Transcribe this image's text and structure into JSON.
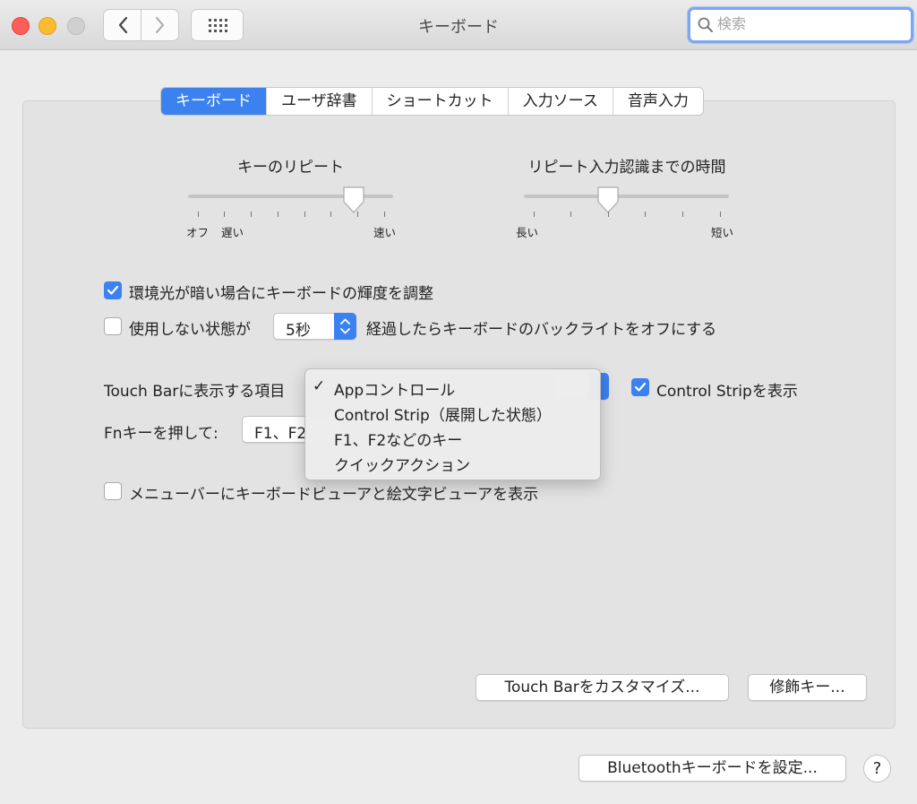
{
  "window": {
    "title": "キーボード"
  },
  "search": {
    "placeholder": "検索"
  },
  "tabs": [
    {
      "label": "キーボード",
      "active": true
    },
    {
      "label": "ユーザ辞書",
      "active": false
    },
    {
      "label": "ショートカット",
      "active": false
    },
    {
      "label": "入力ソース",
      "active": false
    },
    {
      "label": "音声入力",
      "active": false
    }
  ],
  "key_repeat": {
    "title": "キーのリピート",
    "label_off": "オフ",
    "label_slow": "遅い",
    "label_fast": "速い",
    "value_fraction": 0.81
  },
  "repeat_delay": {
    "title": "リピート入力認識までの時間",
    "label_long": "長い",
    "label_short": "短い",
    "value_fraction": 0.41
  },
  "ambient_light": {
    "label": "環境光が暗い場合にキーボードの輝度を調整",
    "checked": true
  },
  "backlight_off": {
    "label_before": "使用しない状態が",
    "value": "5秒",
    "label_after": "経過したらキーボードのバックライトをオフにする",
    "checked": false
  },
  "touchbar": {
    "label": "Touch Barに表示する項目",
    "control_strip_label": "Control Stripを表示",
    "control_strip_checked": true
  },
  "fn_key": {
    "label": "Fnキーを押して:",
    "value": "F1、F2"
  },
  "dropdown_menu": {
    "items": [
      {
        "label": "Appコントロール",
        "checked": true
      },
      {
        "label": "Control Strip（展開した状態）",
        "checked": false
      },
      {
        "label": "F1、F2などのキー",
        "checked": false
      },
      {
        "label": "クイックアクション",
        "checked": false
      }
    ]
  },
  "menubar_viewer": {
    "label": "メニューバーにキーボードビューアと絵文字ビューアを表示",
    "checked": false
  },
  "buttons": {
    "customize_touchbar": "Touch Barをカスタマイズ...",
    "modifier_keys": "修飾キー...",
    "bluetooth": "Bluetoothキーボードを設定...",
    "help": "?"
  },
  "colors": {
    "accent": "#3b82f0"
  }
}
